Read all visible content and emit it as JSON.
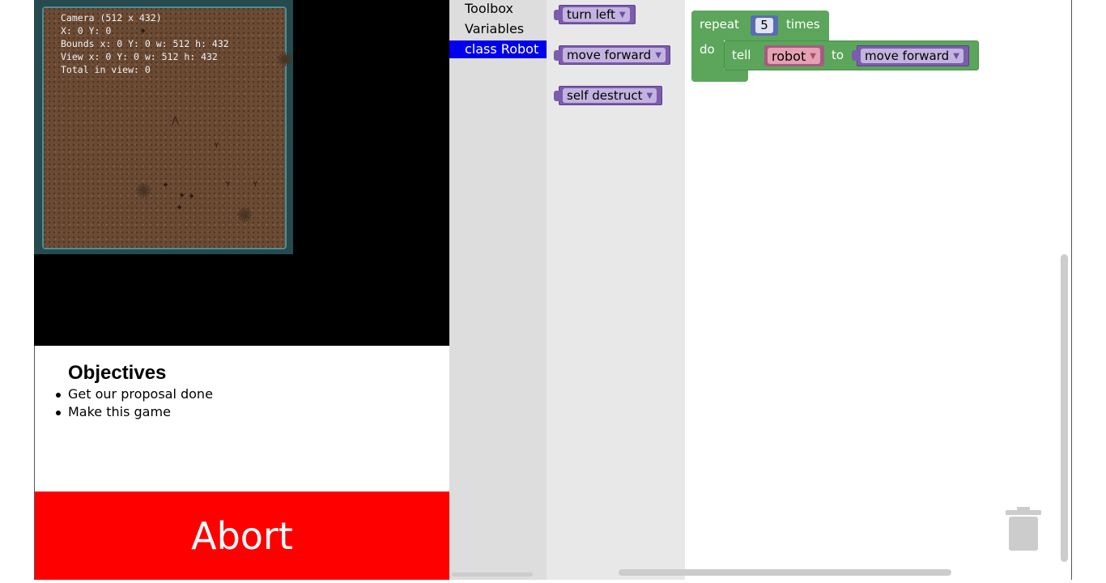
{
  "debug_lines": [
    "Camera (512 x 432)",
    "X: 0 Y: 0",
    "Bounds x: 0 Y: 0 w: 512 h: 432",
    "View x: 0 Y: 0 w: 512 h: 432",
    "Total in view: 0"
  ],
  "objectives": {
    "title": "Objectives",
    "items": [
      "Get our proposal done",
      "Make this game"
    ]
  },
  "abort_label": "Abort",
  "toolbox": {
    "categories": [
      {
        "label": "Toolbox",
        "selected": false
      },
      {
        "label": "Variables",
        "selected": false
      },
      {
        "label": "class Robot",
        "selected": true
      }
    ]
  },
  "flyout_blocks": [
    {
      "label": "turn left"
    },
    {
      "label": "move forward"
    },
    {
      "label": "self destruct"
    }
  ],
  "workspace": {
    "repeat_label": "repeat",
    "repeat_count": "5",
    "times_label": "times",
    "do_label": "do",
    "tell_label": "tell",
    "target": "robot",
    "to_label": "to",
    "action": "move forward"
  },
  "colors": {
    "abort_bg": "#ff0000",
    "selected_category": "#0000ee",
    "loop_block": "#5ba65b",
    "robot_block": "#7b5cad"
  }
}
